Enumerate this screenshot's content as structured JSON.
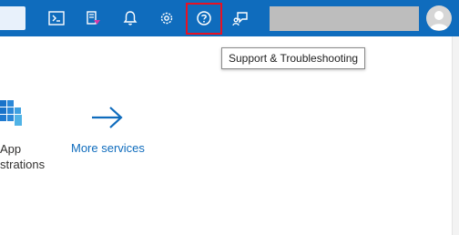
{
  "topbar": {
    "icons": [
      "cloud-shell-icon",
      "directory-filter-icon",
      "notifications-bell-icon",
      "settings-gear-icon",
      "help-question-icon",
      "feedback-icon"
    ]
  },
  "tooltip": {
    "text": "Support & Troubleshooting"
  },
  "services": {
    "app_label_line1": "App",
    "app_label_line2": "strations",
    "more_label": "More services"
  }
}
